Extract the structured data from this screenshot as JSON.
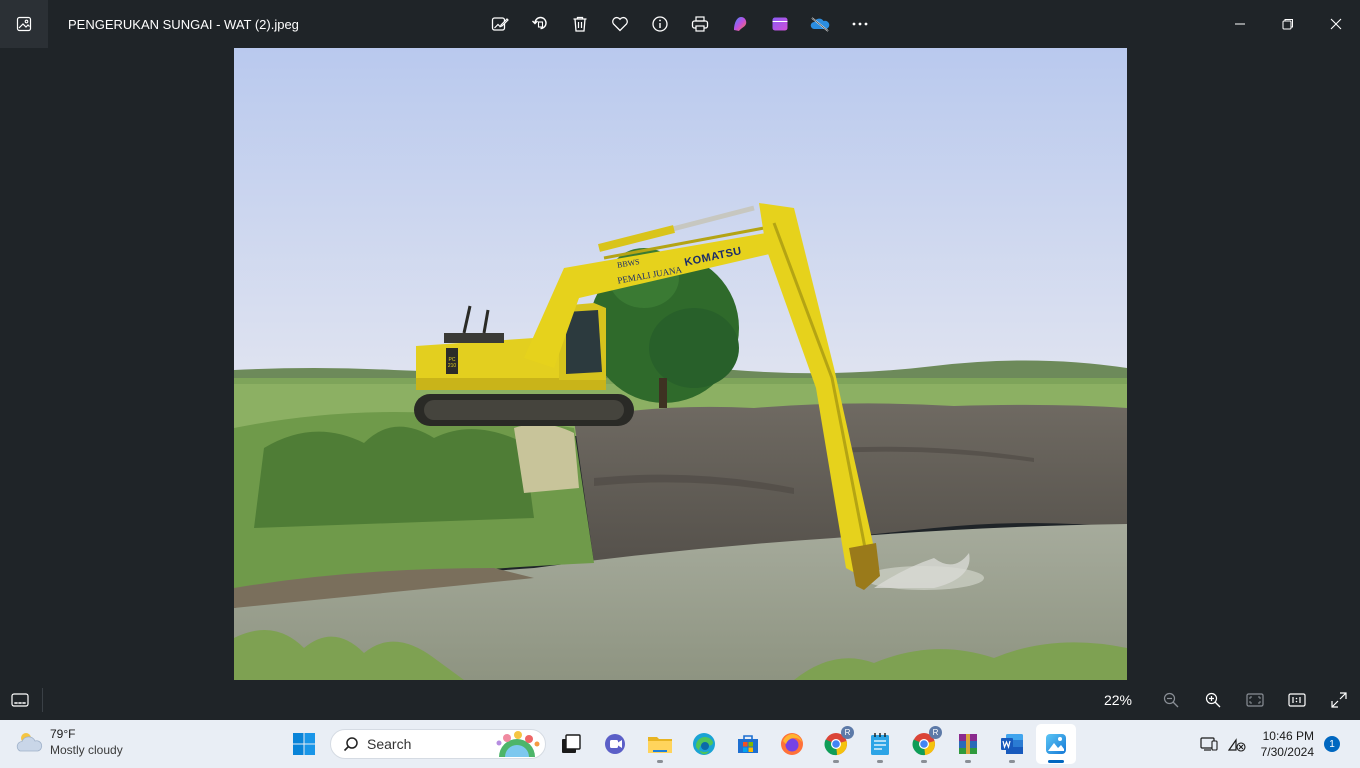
{
  "window": {
    "title": "PENGERUKAN SUNGAI - WAT (2).jpeg"
  },
  "toolbar": {
    "icons": [
      "edit-image-icon",
      "rotate-icon",
      "delete-icon",
      "favorite-icon",
      "info-icon",
      "print-icon",
      "copilot-icon",
      "clipchamp-icon",
      "onedrive-icon",
      "more-icon"
    ]
  },
  "statusbar": {
    "zoom": "22%"
  },
  "taskbar": {
    "weather": {
      "temp": "79°F",
      "desc": "Mostly cloudy"
    },
    "search_placeholder": "Search",
    "chrome_badge": "R",
    "chrome2_badge": "R",
    "time": "10:46 PM",
    "date": "7/30/2024",
    "notifications": "1"
  },
  "photo": {
    "excavator_text_1": "BBWS",
    "excavator_text_2": "PEMALI JUANA",
    "excavator_brand": "KOMATSU",
    "model": "PC 210"
  },
  "colors": {
    "chrome_bg": "#1f2428",
    "taskbar_bg": "#e9eef5",
    "accent": "#0067c0",
    "excavator_yellow": "#e8d21a"
  }
}
